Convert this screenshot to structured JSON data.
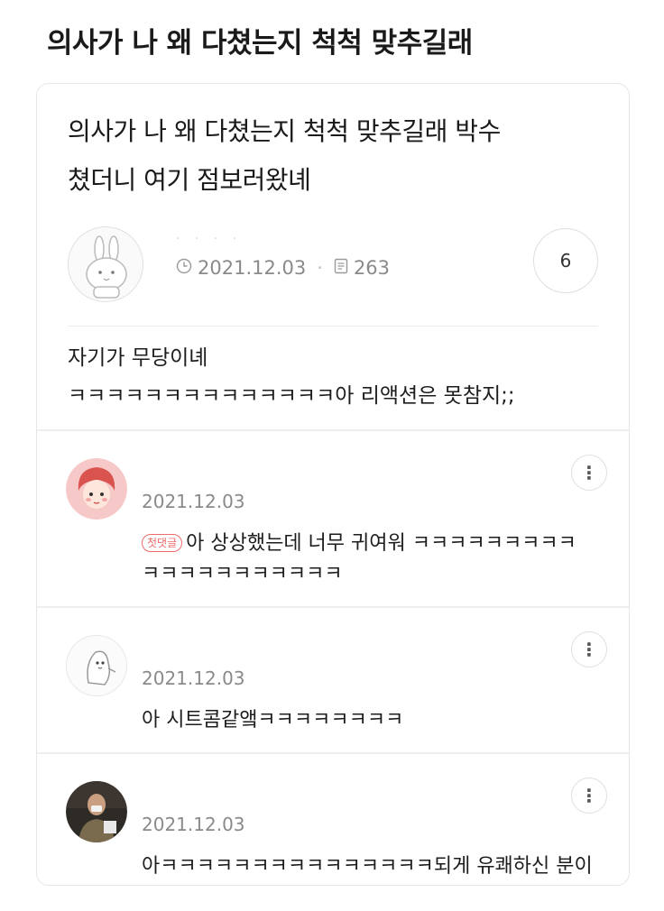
{
  "page_title": "의사가 나 왜 다쳤는지 척척 맞추길래",
  "post": {
    "title_line1": "의사가 나 왜 다쳤는지 척척 맞추길래 박수",
    "title_line2": "쳤더니 여기 점보러왔녜",
    "author_name": "·  ·  ·  ·",
    "date": "2021.12.03",
    "views": "263",
    "comment_count": "6",
    "body_line1": "자기가 무당이녜",
    "body_line2": "ㅋㅋㅋㅋㅋㅋㅋㅋㅋㅋㅋㅋㅋㅋ아 리액션은 못참지;;"
  },
  "comments": [
    {
      "date": "2021.12.03",
      "badge": "첫댓글",
      "text": "아 상상했는데 너무 귀여워 ㅋㅋㅋㅋㅋㅋㅋㅋㅋㅋㅋㅋㅋㅋㅋㅋㅋㅋㅋㅋ"
    },
    {
      "date": "2021.12.03",
      "text": "아 시트콤같앸ㅋㅋㅋㅋㅋㅋㅋㅋ"
    },
    {
      "date": "2021.12.03",
      "text": "아ㅋㅋㅋㅋㅋㅋㅋㅋㅋㅋㅋㅋㅋㅋㅋ되게 유쾌하신 분이시녴ㅌㅋㅋㅋㅋㅋㅋ"
    }
  ],
  "icons": {
    "clock": "clock-icon",
    "views": "document-icon",
    "more": "more-vertical-icon"
  },
  "colors": {
    "badge": "#ef6b6b",
    "meta": "#8a8a8a"
  }
}
